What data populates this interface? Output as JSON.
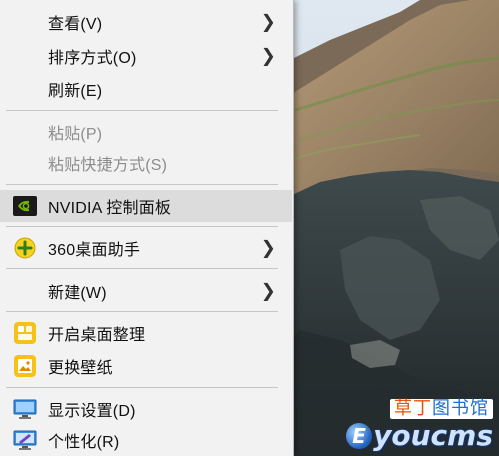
{
  "menu": {
    "items": [
      {
        "label": "查看(V)",
        "icon": "none",
        "submenu": true,
        "disabled": false
      },
      {
        "label": "排序方式(O)",
        "icon": "none",
        "submenu": true,
        "disabled": false
      },
      {
        "label": "刷新(E)",
        "icon": "none",
        "submenu": false,
        "disabled": false
      },
      {
        "label": "粘贴(P)",
        "icon": "none",
        "submenu": false,
        "disabled": true
      },
      {
        "label": "粘贴快捷方式(S)",
        "icon": "none",
        "submenu": false,
        "disabled": true
      },
      {
        "label": "NVIDIA 控制面板",
        "icon": "nvidia-icon",
        "submenu": false,
        "disabled": false
      },
      {
        "label": "360桌面助手",
        "icon": "360-assistant-icon",
        "submenu": true,
        "disabled": false
      },
      {
        "label": "新建(W)",
        "icon": "none",
        "submenu": true,
        "disabled": false
      },
      {
        "label": "开启桌面整理",
        "icon": "desktop-organize-icon",
        "submenu": false,
        "disabled": false
      },
      {
        "label": "更换壁纸",
        "icon": "wallpaper-icon",
        "submenu": false,
        "disabled": false
      },
      {
        "label": "显示设置(D)",
        "icon": "display-settings-icon",
        "submenu": false,
        "disabled": false
      },
      {
        "label": "个性化(R)",
        "icon": "personalize-icon",
        "submenu": false,
        "disabled": false
      }
    ],
    "submenu_arrow": "❯"
  },
  "watermark": {
    "top_part1": "草丁",
    "top_part2": "图书馆",
    "bottom_e": "E",
    "bottom_rest": "youcms"
  },
  "colors": {
    "menu_bg": "#f2f2f2",
    "hover_bg": "#dcdcdc",
    "disabled_text": "#8d8d8d",
    "nvidia_green": "#76b900",
    "yellow_360": "#f7d21e"
  }
}
